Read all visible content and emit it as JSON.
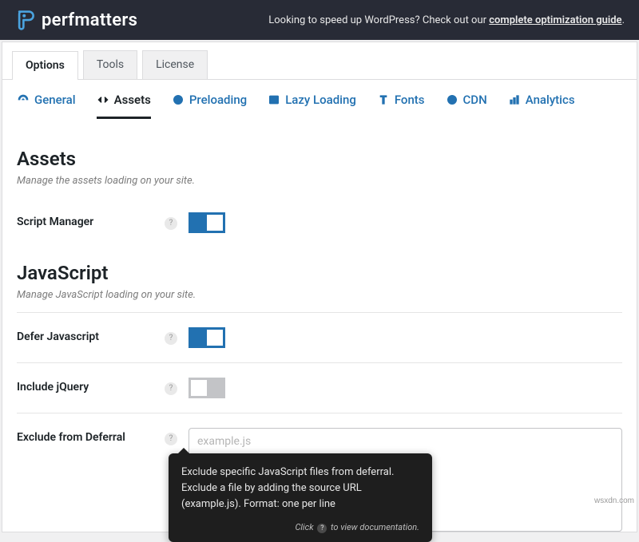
{
  "brand": "perfmatters",
  "banner": {
    "prefix": "Looking to speed up WordPress? Check out our ",
    "link": "complete optimization guide",
    "suffix": "."
  },
  "mainTabs": {
    "options": "Options",
    "tools": "Tools",
    "license": "License"
  },
  "subnav": {
    "general": "General",
    "assets": "Assets",
    "preloading": "Preloading",
    "lazy": "Lazy Loading",
    "fonts": "Fonts",
    "cdn": "CDN",
    "analytics": "Analytics"
  },
  "sections": {
    "assets": {
      "title": "Assets",
      "subtitle": "Manage the assets loading on your site."
    },
    "js": {
      "title": "JavaScript",
      "subtitle": "Manage JavaScript loading on your site."
    }
  },
  "rows": {
    "scriptManager": "Script Manager",
    "deferJs": "Defer Javascript",
    "includeJquery": "Include jQuery",
    "excludeDeferral": "Exclude from Deferral",
    "excludePlaceholder": "example.js"
  },
  "tooltip": {
    "body": "Exclude specific JavaScript files from deferral. Exclude a file by adding the source URL (example.js). Format: one per line",
    "footPrefix": "Click ",
    "footSuffix": " to view documentation."
  },
  "watermark": "wsxdn.com"
}
